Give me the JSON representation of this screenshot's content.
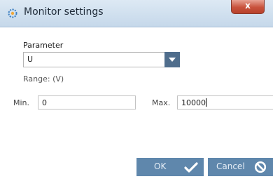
{
  "window": {
    "title": "Monitor settings",
    "close_glyph": "x"
  },
  "form": {
    "parameter_label": "Parameter",
    "parameter_value": "U",
    "range_label": "Range: (V)",
    "min_label": "Min.",
    "min_value": "0",
    "max_label": "Max.",
    "max_value": "10000"
  },
  "buttons": {
    "ok_label": "OK",
    "cancel_label": "Cancel"
  },
  "icons": {
    "app": "gear-icon",
    "dropdown": "chevron-down-icon",
    "ok": "checkmark-icon",
    "cancel": "no-sign-icon"
  },
  "colors": {
    "button_bg": "#5f87ac",
    "dropdown_bg": "#4f6d8c",
    "close_bg": "#c8523c"
  }
}
